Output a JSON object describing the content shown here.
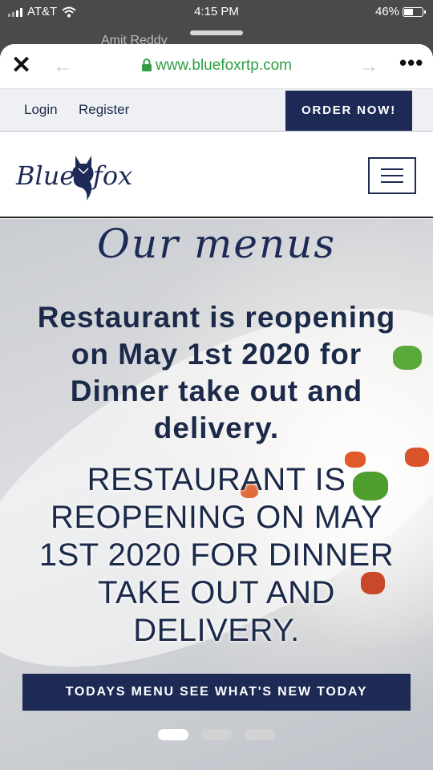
{
  "status_bar": {
    "carrier": "AT&T",
    "time": "4:15 PM",
    "battery": "46%"
  },
  "behind_sheet_name": "Amit Reddy",
  "browser": {
    "url": "www.bluefoxrtp.com"
  },
  "topnav": {
    "login": "Login",
    "register": "Register",
    "order_button": "ORDER NOW!"
  },
  "header": {
    "logo_word1": "Blue",
    "logo_word2": "fox"
  },
  "hero": {
    "title": "Our menus",
    "bold_line1": "Restaurant is reopening",
    "bold_line2": "on May 1st 2020 for",
    "bold_line3": "Dinner take out and",
    "bold_line4": "delivery.",
    "caps_line1": "RESTAURANT IS",
    "caps_line2": "REOPENING ON MAY",
    "caps_line3": "1ST 2020 FOR DINNER",
    "caps_line4": "TAKE OUT AND",
    "caps_line5": "DELIVERY.",
    "menu_button": "TODAYS MENU SEE WHAT'S NEW TODAY"
  },
  "carousel": {
    "slides": 3,
    "active_index": 0
  },
  "colors": {
    "navy": "#1c2a55",
    "url_green": "#2f9e44"
  }
}
